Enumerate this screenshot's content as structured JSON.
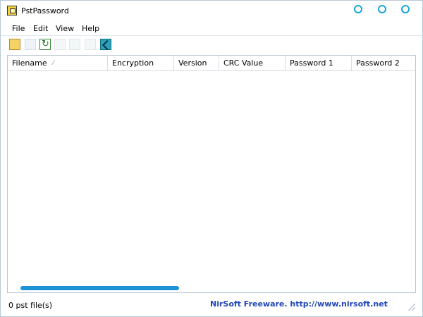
{
  "window": {
    "title": "PstPassword",
    "accent_color": "#1aa3db"
  },
  "menu": {
    "items": [
      "File",
      "Edit",
      "View",
      "Help"
    ]
  },
  "toolbar": {
    "icons": [
      "open-folder-icon",
      "save-icon",
      "refresh-icon",
      "copy-icon",
      "properties-icon",
      "find-icon",
      "exit-icon"
    ]
  },
  "table": {
    "columns": [
      "Filename",
      "Encryption",
      "Version",
      "CRC Value",
      "Password 1",
      "Password 2"
    ],
    "rows": []
  },
  "statusbar": {
    "left": "0 pst file(s)",
    "right": "NirSoft Freeware.  http://www.nirsoft.net",
    "right_color": "#2046b8"
  }
}
